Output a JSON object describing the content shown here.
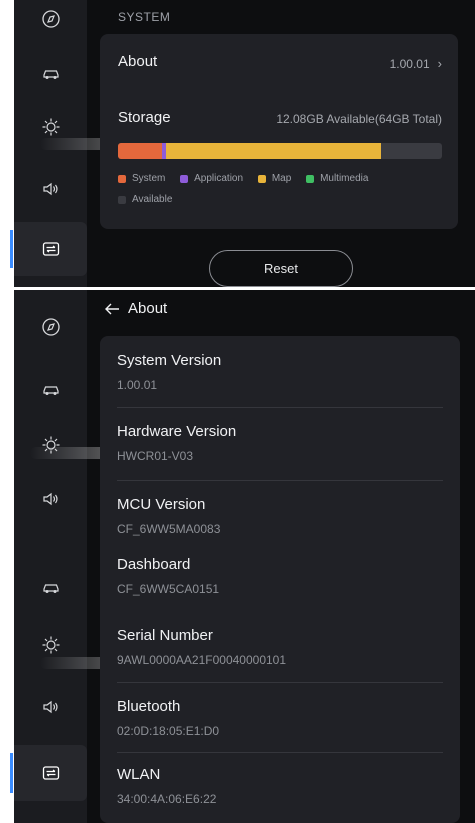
{
  "system_screen": {
    "section_title": "SYSTEM",
    "about": {
      "label": "About",
      "value": "1.00.01"
    },
    "storage": {
      "label": "Storage",
      "summary": "12.08GB Available(64GB Total)",
      "segments": [
        {
          "name": "System",
          "fraction": 0.137,
          "color": "#e4683c"
        },
        {
          "name": "Application",
          "fraction": 0.012,
          "color": "#8e5cd9"
        },
        {
          "name": "Map",
          "fraction": 0.664,
          "color": "#e8b43a"
        },
        {
          "name": "Multimedia",
          "fraction": 0.0,
          "color": "#3fbf63"
        }
      ],
      "available_color": "#3a3b41"
    },
    "legend": [
      "System",
      "Application",
      "Map",
      "Multimedia",
      "Available"
    ],
    "reset_label": "Reset"
  },
  "about_screen": {
    "back_title": "About",
    "items": [
      {
        "label": "System Version",
        "value": "1.00.01"
      },
      {
        "label": "Hardware Version",
        "value": "HWCR01-V03"
      },
      {
        "label": "MCU Version",
        "value": "CF_6WW5MA0083"
      },
      {
        "label": "Dashboard",
        "value": "CF_6WW5CA0151"
      },
      {
        "label": "Serial Number",
        "value": "9AWL0000AA21F00040000101"
      },
      {
        "label": "Bluetooth",
        "value": "02:0D:18:05:E1:D0"
      },
      {
        "label": "WLAN",
        "value": "34:00:4A:06:E6:22"
      }
    ]
  },
  "sidebar_icons": [
    "navigation-icon",
    "vehicle-icon",
    "brightness-icon",
    "volume-icon",
    "settings-toggle-icon"
  ],
  "colors": {
    "background": "#0d0e10",
    "card": "#202126",
    "sidebar": "#1b1c20",
    "accent": "#3a8cff"
  }
}
